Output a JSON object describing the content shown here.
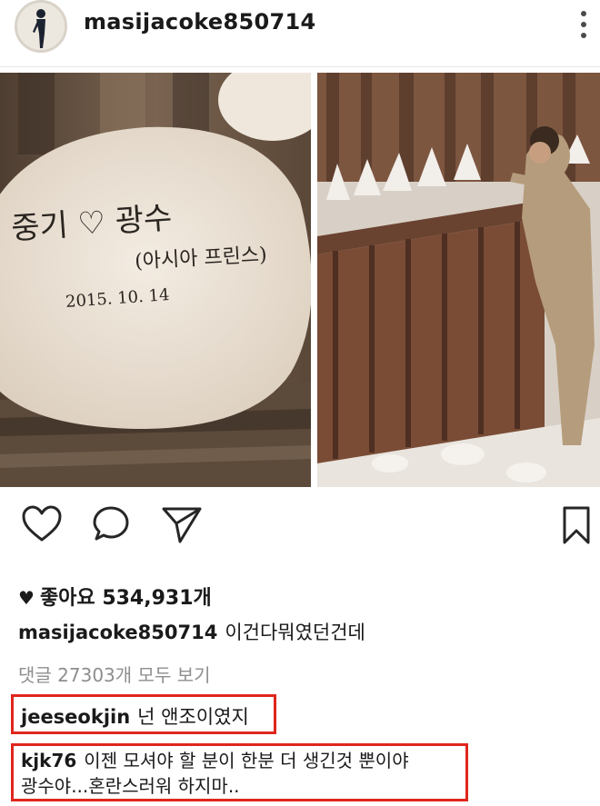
{
  "post": {
    "username": "masijacoke850714"
  },
  "photos": {
    "left": {
      "line1": "중기 ♡ 광수",
      "line2": "(아시아 프린스)",
      "line3": "2015. 10. 14"
    }
  },
  "engagement": {
    "likes_label": "좋아요 534,931개"
  },
  "caption": {
    "username": "masijacoke850714",
    "text": "이건다뭐였던건데"
  },
  "comments": {
    "view_all": "댓글 27303개 모두 보기",
    "items": [
      {
        "username": "jeeseokjin",
        "text": "넌  앤조이였지"
      },
      {
        "username": "kjk76",
        "text": "이젠 모셔야 할 분이 한분 더 생긴것 뿐이야",
        "text2": "광수야...혼란스러워 하지마.."
      }
    ]
  },
  "icons": [
    "heart-icon",
    "comment-icon",
    "share-icon",
    "bookmark-icon",
    "more-options-icon"
  ],
  "colors": {
    "highlight_box": "#e0261c",
    "text": "#262626",
    "muted": "#8e8e8e"
  }
}
